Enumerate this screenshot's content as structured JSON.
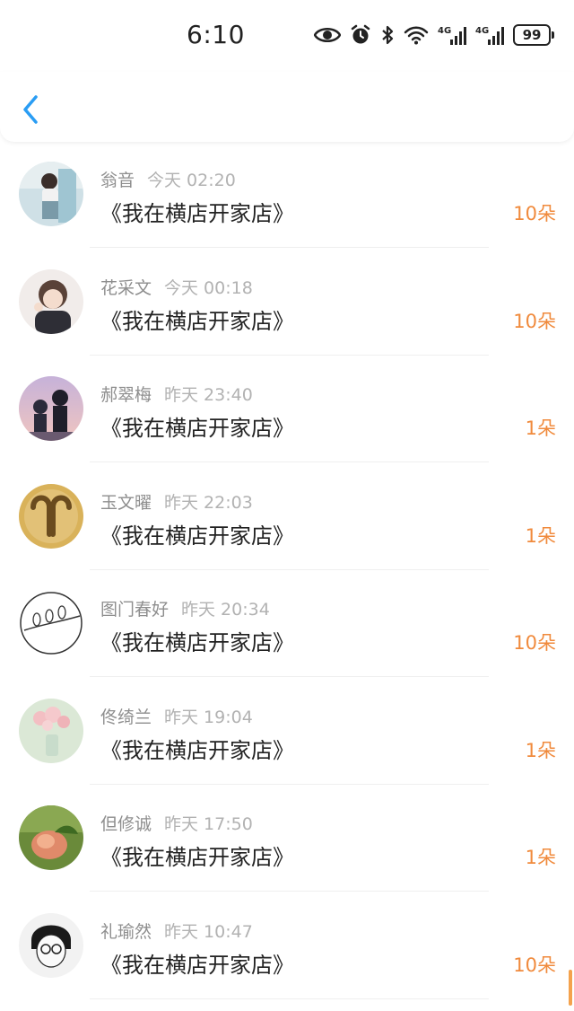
{
  "status_bar": {
    "time": "6:10",
    "battery": "99",
    "icons": [
      "eye-icon",
      "alarm-icon",
      "bluetooth-icon",
      "wifi-icon",
      "signal-4g-icon",
      "signal-4g-icon",
      "battery-icon"
    ]
  },
  "header": {
    "back_icon": "chevron-left-icon",
    "accent": "#2a9df4"
  },
  "items": [
    {
      "name": "翁音",
      "time": "今天 02:20",
      "title": "《我在横店开家店》",
      "amount": "10朵"
    },
    {
      "name": "花采文",
      "time": "今天 00:18",
      "title": "《我在横店开家店》",
      "amount": "10朵"
    },
    {
      "name": "郝翠梅",
      "time": "昨天 23:40",
      "title": "《我在横店开家店》",
      "amount": "1朵"
    },
    {
      "name": "玉文曜",
      "time": "昨天 22:03",
      "title": "《我在横店开家店》",
      "amount": "1朵"
    },
    {
      "name": "图门春好",
      "time": "昨天 20:34",
      "title": "《我在横店开家店》",
      "amount": "10朵"
    },
    {
      "name": "佟绮兰",
      "time": "昨天 19:04",
      "title": "《我在横店开家店》",
      "amount": "1朵"
    },
    {
      "name": "但修诚",
      "time": "昨天 17:50",
      "title": "《我在横店开家店》",
      "amount": "1朵"
    },
    {
      "name": "礼瑜然",
      "time": "昨天 10:47",
      "title": "《我在横店开家店》",
      "amount": "10朵"
    }
  ],
  "colors": {
    "amount": "#f08a3c",
    "name": "#8e8e8e",
    "time": "#b2b2b2",
    "title": "#222222"
  }
}
